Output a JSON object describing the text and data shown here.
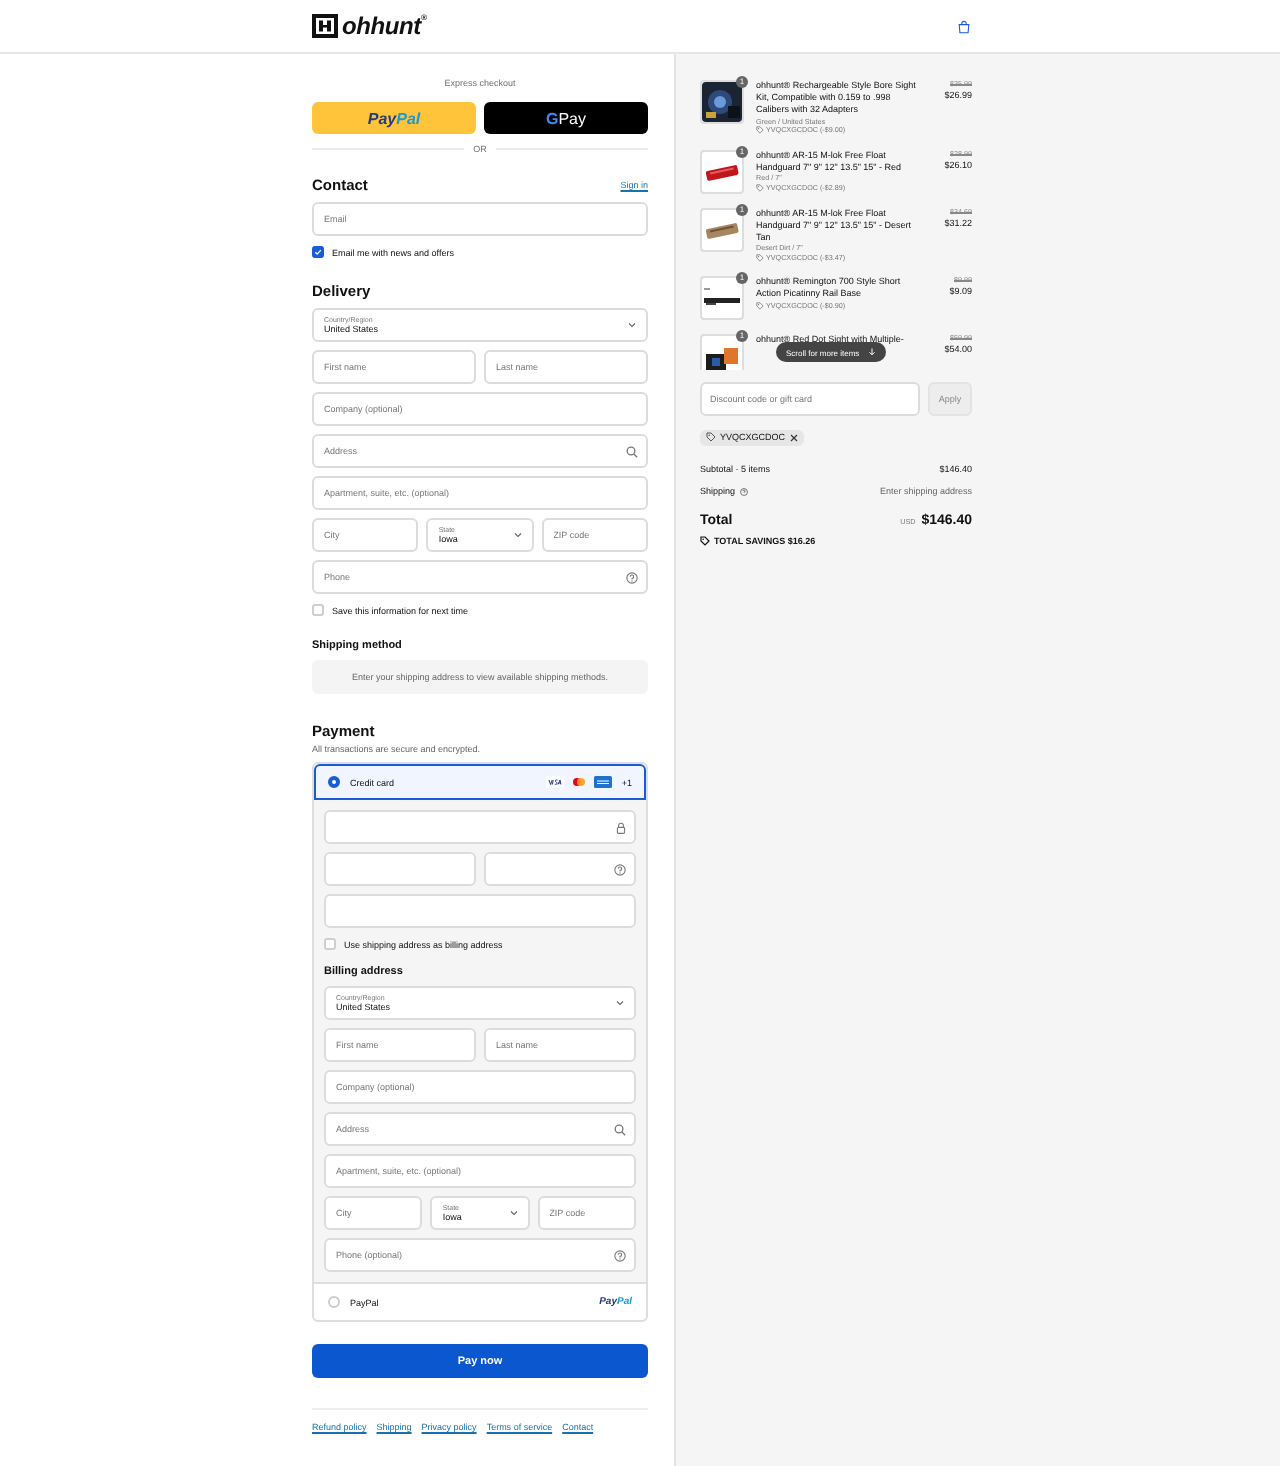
{
  "header": {
    "logo": "ohhunt$^{®}$"
  },
  "express": {
    "title": "Express checkout",
    "paypal": [
      "Pay",
      "Pal"
    ],
    "gpay": [
      "G",
      "Pay"
    ],
    "divider": "OR"
  },
  "contact": {
    "title": "Contact",
    "link": "Sign in",
    "fields": [
      [
        {
          "kind": "input",
          "placeholder": "Email"
        }
      ]
    ],
    "checkbox": {
      "label": "Email me with news and offers",
      "checked": true
    }
  },
  "delivery": {
    "title": "Delivery",
    "fields": [
      [
        {
          "kind": "select",
          "label": "Country/Region",
          "value": "United States"
        }
      ],
      [
        {
          "kind": "input",
          "placeholder": "First name"
        },
        {
          "kind": "input",
          "placeholder": "Last name"
        }
      ],
      [
        {
          "kind": "input",
          "placeholder": "Company (optional)"
        }
      ],
      [
        {
          "kind": "search",
          "placeholder": "Address"
        }
      ],
      [
        {
          "kind": "input",
          "placeholder": "Apartment, suite, etc. (optional)"
        }
      ],
      [
        {
          "kind": "input",
          "placeholder": "City"
        },
        {
          "kind": "select",
          "label": "State",
          "value": "Iowa"
        },
        {
          "kind": "input",
          "placeholder": "ZIP code"
        }
      ],
      [
        {
          "kind": "help",
          "placeholder": "Phone"
        }
      ]
    ],
    "checkbox": {
      "label": "Save this information for next time",
      "checked": false
    }
  },
  "shipping": {
    "title": "Shipping method",
    "notice": "Enter your shipping address to view available shipping methods."
  },
  "payment": {
    "title": "Payment",
    "subtitle": "All transactions are secure and encrypted.",
    "methods": [
      {
        "kind": "card",
        "label": "Credit card",
        "selected": true,
        "brands": [
          {
            "kind": "visa"
          },
          {
            "kind": "mastercard"
          },
          {
            "kind": "amex"
          }
        ],
        "more": "+1",
        "fields": [
          [
            {
              "kind": "lock"
            }
          ],
          [
            {
              "kind": "input"
            },
            {
              "kind": "help"
            }
          ],
          [
            {
              "kind": "input"
            }
          ]
        ],
        "checkbox": {
          "label": "Use shipping address as billing address",
          "checked": false
        },
        "billing_title": "Billing address",
        "billing_fields": [
          [
            {
              "kind": "select",
              "label": "Country/Region",
              "value": "United States"
            }
          ],
          [
            {
              "kind": "input",
              "placeholder": "First name"
            },
            {
              "kind": "input",
              "placeholder": "Last name"
            }
          ],
          [
            {
              "kind": "input",
              "placeholder": "Company (optional)"
            }
          ],
          [
            {
              "kind": "search",
              "placeholder": "Address"
            }
          ],
          [
            {
              "kind": "input",
              "placeholder": "Apartment, suite, etc. (optional)"
            }
          ],
          [
            {
              "kind": "input",
              "placeholder": "City"
            },
            {
              "kind": "select",
              "label": "State",
              "value": "Iowa"
            },
            {
              "kind": "input",
              "placeholder": "ZIP code"
            }
          ],
          [
            {
              "kind": "help",
              "placeholder": "Phone (optional)"
            }
          ]
        ]
      },
      {
        "kind": "paypal",
        "label": "PayPal",
        "selected": false,
        "logo": [
          "Pay",
          "Pal"
        ]
      }
    ]
  },
  "pay_button": "Pay now",
  "footer_links": [
    "Refund policy",
    "Shipping",
    "Privacy policy",
    "Terms of service",
    "Contact"
  ],
  "summary": {
    "items": [
      {
        "quantity": "1",
        "name": "ohhunt® Rechargeable Style Bore Sight Kit, Compatible with 0.159 to .998 Calibers with 32 Adapters",
        "variant": "Green / United States",
        "discount": "YVQCXGCDOC (-$9.00)",
        "old_price": "$35.99",
        "price": "$26.99"
      },
      {
        "quantity": "1",
        "name": "ohhunt® AR-15 M-lok Free Float Handguard 7\" 9\" 12\" 13.5\" 15\" - Red",
        "variant": "Red / 7\"",
        "discount": "YVQCXGCDOC (-$2.89)",
        "old_price": "$28.99",
        "price": "$26.10"
      },
      {
        "quantity": "1",
        "name": "ohhunt® AR-15 M-lok Free Float Handguard 7\" 9\" 12\" 13.5\" 15\" - Desert Tan",
        "variant": "Desert Dirt / 7\"",
        "discount": "YVQCXGCDOC (-$3.47)",
        "old_price": "$34.69",
        "price": "$31.22"
      },
      {
        "quantity": "1",
        "name": "ohhunt® Remington 700 Style Short Action Picatinny Rail Base",
        "discount": "YVQCXGCDOC (-$0.90)",
        "old_price": "$9.99",
        "price": "$9.09"
      },
      {
        "quantity": "1",
        "name": "ohhunt® Red Dot Sight with Multiple-",
        "old_price": "$59.99",
        "price": "$54.00"
      }
    ],
    "scroll_hint": "Scroll for more items",
    "discount_placeholder": "Discount code or gift card",
    "apply": "Apply",
    "applied_code": "YVQCXGCDOC",
    "subtotal_label": "Subtotal · 5 items",
    "subtotal": "$146.40",
    "shipping_label": "Shipping",
    "shipping_value": "Enter shipping address",
    "total_label": "Total",
    "currency": "USD",
    "total": "$146.40",
    "savings": "TOTAL SAVINGS $16.26"
  }
}
